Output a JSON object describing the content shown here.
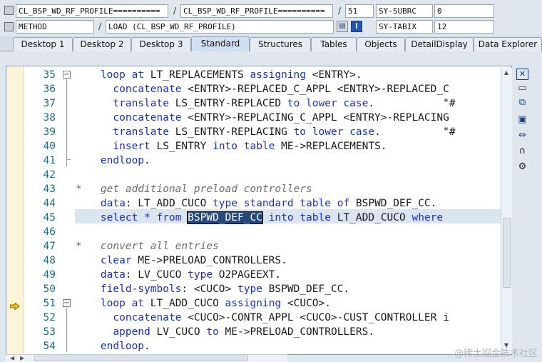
{
  "header": {
    "row1": {
      "program": "CL_BSP_WD_RF_PROFILE==========",
      "sep1": "/",
      "include": "CL_BSP_WD_RF_PROFILE==========",
      "sep2": "/",
      "line": "51",
      "sysfield1_name": "SY-SUBRC",
      "sysfield1_value": "0"
    },
    "row2": {
      "type": "METHOD",
      "sep": "/",
      "event": "LOAD (CL_BSP_WD_RF_PROFILE)",
      "sysfield2_name": "SY-TABIX",
      "sysfield2_value": "12"
    }
  },
  "tabs": [
    {
      "label": "Desktop 1"
    },
    {
      "label": "Desktop 2"
    },
    {
      "label": "Desktop 3"
    },
    {
      "label": "Standard"
    },
    {
      "label": "Structures"
    },
    {
      "label": "Tables"
    },
    {
      "label": "Objects"
    },
    {
      "label": "DetailDisplay"
    },
    {
      "label": "Data Explorer"
    }
  ],
  "active_tab": "Standard",
  "current_line": "51",
  "selection": "BSPWD_DEF_CC",
  "code_lines": [
    {
      "n": "35",
      "t": "    loop at LT_REPLACEMENTS assigning <ENTRY>."
    },
    {
      "n": "36",
      "t": "      concatenate <ENTRY>-REPLACED_C_APPL <ENTRY>-REPLACED_C"
    },
    {
      "n": "37",
      "t": "      translate LS_ENTRY-REPLACED to lower case.           \"#"
    },
    {
      "n": "38",
      "t": "      concatenate <ENTRY>-REPLACING_C_APPL <ENTRY>-REPLACING"
    },
    {
      "n": "39",
      "t": "      translate LS_ENTRY-REPLACING to lower case.          \"#"
    },
    {
      "n": "40",
      "t": "      insert LS_ENTRY into table ME->REPLACEMENTS."
    },
    {
      "n": "41",
      "t": "    endloop."
    },
    {
      "n": "42",
      "t": ""
    },
    {
      "n": "43",
      "t": "*   get additional preload controllers"
    },
    {
      "n": "44",
      "t": "    data: LT_ADD_CUCO type standard table of BSPWD_DEF_CC."
    },
    {
      "n": "45",
      "t": "    select * from BSPWD_DEF_CC into table LT_ADD_CUCO where"
    },
    {
      "n": "46",
      "t": ""
    },
    {
      "n": "47",
      "t": "*   convert all entries"
    },
    {
      "n": "48",
      "t": "    clear ME->PRELOAD_CONTROLLERS."
    },
    {
      "n": "49",
      "t": "    data: LV_CUCO type O2PAGEEXT."
    },
    {
      "n": "50",
      "t": "    field-symbols: <CUCO> type BSPWD_DEF_CC."
    },
    {
      "n": "51",
      "t": "    loop at LT_ADD_CUCO assigning <CUCO>."
    },
    {
      "n": "52",
      "t": "      concatenate <CUCO>-CONTR_APPL <CUCO>-CUST_CONTROLLER i"
    },
    {
      "n": "53",
      "t": "      append LV_CUCO to ME->PRELOAD_CONTROLLERS."
    },
    {
      "n": "54",
      "t": "    endloop."
    }
  ],
  "watermark": "@稀土掘金技术社区",
  "icons": {
    "close": "close-icon",
    "new": "new-window-icon",
    "copy": "copy-icon",
    "fullscreen": "fullscreen-icon",
    "resize": "resize-icon",
    "headset": "headset-icon",
    "settings": "settings-icon"
  }
}
